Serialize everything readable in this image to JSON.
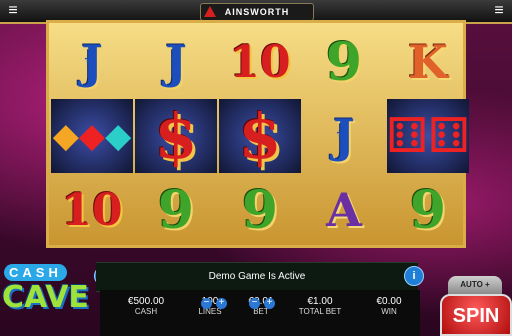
{
  "brand": {
    "name": "AINSWORTH"
  },
  "game": {
    "logo_top": "CASH",
    "logo_bottom": "CAVE"
  },
  "reels": [
    [
      "J",
      "gems",
      "10"
    ],
    [
      "J",
      "$",
      "9"
    ],
    [
      "10",
      "$",
      "9"
    ],
    [
      "9",
      "J",
      "A"
    ],
    [
      "K",
      "dice",
      "9"
    ]
  ],
  "symbols": {
    "dollar": "$",
    "dice": "⚅",
    "gems": "◆",
    "fleur": "⚜"
  },
  "message": {
    "text": "Demo Game Is Active"
  },
  "buttons": {
    "sound_icon": "speaker-icon",
    "info_label": "i",
    "auto_label": "AUTO",
    "spin_label": "SPIN",
    "menu": "≡",
    "plus": "+",
    "minus": "−"
  },
  "meters": {
    "cash": {
      "value": "€500.00",
      "label": "CASH"
    },
    "lines": {
      "value": "100",
      "label": "LINES"
    },
    "bet": {
      "value": "€0.01",
      "label": "BET"
    },
    "total_bet": {
      "value": "€1.00",
      "label": "TOTAL BET"
    },
    "win": {
      "value": "€0.00",
      "label": "WIN"
    }
  },
  "colors": {
    "accent_gold": "#d9ae48",
    "spin_red": "#d81f1f",
    "button_blue": "#1f7fd6"
  }
}
